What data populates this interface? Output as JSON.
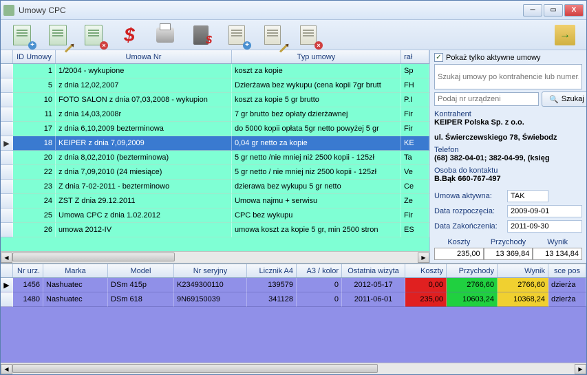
{
  "window": {
    "title": "Umowy CPC"
  },
  "grid": {
    "headers": {
      "id": "ID Umowy",
      "nr": "Umowa Nr",
      "typ": "Typ umowy",
      "kon": "rał"
    },
    "rows": [
      {
        "id": 1,
        "nr": "1/2004   - wykupione",
        "typ": "koszt za kopie",
        "kon": "Sp"
      },
      {
        "id": 5,
        "nr": "z dnia 12,02,2007",
        "typ": "Dzierżawa bez wykupu (cena kopii 7gr brutt",
        "kon": "FH"
      },
      {
        "id": 10,
        "nr": "FOTO SALON z dnia 07,03,2008 - wykupion",
        "typ": "koszt za kopie 5 gr brutto",
        "kon": "P.I"
      },
      {
        "id": 11,
        "nr": "z dnia 14,03,2008r",
        "typ": "7 gr brutto bez opłaty dzierżawnej",
        "kon": "Fir"
      },
      {
        "id": 17,
        "nr": "z dnia 6,10,2009 bezterminowa",
        "typ": "do 5000 kopii opłata 5gr netto powyżej 5 gr",
        "kon": "Fir"
      },
      {
        "id": 18,
        "nr": "KEIPER z dnia 7,09,2009",
        "typ": "0,04 gr netto za kopie",
        "kon": "KE",
        "sel": true
      },
      {
        "id": 20,
        "nr": "z dnia 8,02,2010 (bezterminowa)",
        "typ": "5 gr netto /nie mniej niż 2500 kopii - 125zł",
        "kon": "Ta"
      },
      {
        "id": 22,
        "nr": "z dnia 7,09,2010  (24 miesiące)",
        "typ": "5 gr netto / nie mniej niz 2500 kopii - 125zł",
        "kon": "Ve"
      },
      {
        "id": 23,
        "nr": "Z dnia 7-02-2011 - bezterminowo",
        "typ": "dzierawa bez wykupu 5 gr netto",
        "kon": "Ce"
      },
      {
        "id": 24,
        "nr": "ZST Z dnia 29.12.2011",
        "typ": "Umowa najmu + serwisu",
        "kon": "Ze"
      },
      {
        "id": 25,
        "nr": "Umowa CPC z dnia 1.02.2012",
        "typ": "CPC bez wykupu",
        "kon": "Fir"
      },
      {
        "id": 26,
        "nr": "umowa 2012-IV",
        "typ": "umowa koszt za kopie 5 gr, min 2500 stron",
        "kon": "ES"
      }
    ]
  },
  "side": {
    "chk_label": "Pokaż tylko aktywne umowy",
    "search_placeholder": "Szukaj umowy po kontrahencie lub numerz",
    "device_placeholder": "Podaj nr urządzeni",
    "search_btn": "Szukaj",
    "kontrahent_lbl": "Kontrahent",
    "kontrahent": "KEIPER Polska Sp. z o.o.",
    "adres": "ul. Świerczewskiego 78, Świebodz",
    "telefon_lbl": "Telefon",
    "telefon": "(68) 382-04-01; 382-04-99, (księg",
    "osoba_lbl": "Osoba do kontaktu",
    "osoba": "B.Bąk 660-767-497",
    "aktywna_lbl": "Umowa aktywna:",
    "aktywna": "TAK",
    "start_lbl": "Data rozpoczęcia:",
    "start": "2009-09-01",
    "end_lbl": "Data Zakończenia:",
    "end": "2011-09-30",
    "totals": {
      "koszty_h": "Koszty",
      "koszty": "235,00",
      "przychody_h": "Przychody",
      "przychody": "13 369,84",
      "wynik_h": "Wynik",
      "wynik": "13 134,84"
    }
  },
  "bottom": {
    "headers": {
      "nr": "Nr urz.",
      "marka": "Marka",
      "model": "Model",
      "ser": "Nr seryjny",
      "lic": "Licznik A4",
      "kol": "A3 / kolor",
      "wiz": "Ostatnia wizyta",
      "kos": "Koszty",
      "prz": "Przychody",
      "wyn": "Wynik",
      "sce": "sce pos"
    },
    "rows": [
      {
        "nr": 1456,
        "marka": "Nashuatec",
        "model": "DSm 415p",
        "ser": "K2349300110",
        "lic": "139579",
        "kol": "0",
        "wiz": "2012-05-17",
        "kos": "0,00",
        "prz": "2766,60",
        "wyn": "2766,60",
        "sce": "dzierża"
      },
      {
        "nr": 1480,
        "marka": "Nashuatec",
        "model": "DSm 618",
        "ser": "9N69150039",
        "lic": "341128",
        "kol": "0",
        "wiz": "2011-06-01",
        "kos": "235,00",
        "prz": "10603,24",
        "wyn": "10368,24",
        "sce": "dzierża"
      }
    ]
  }
}
